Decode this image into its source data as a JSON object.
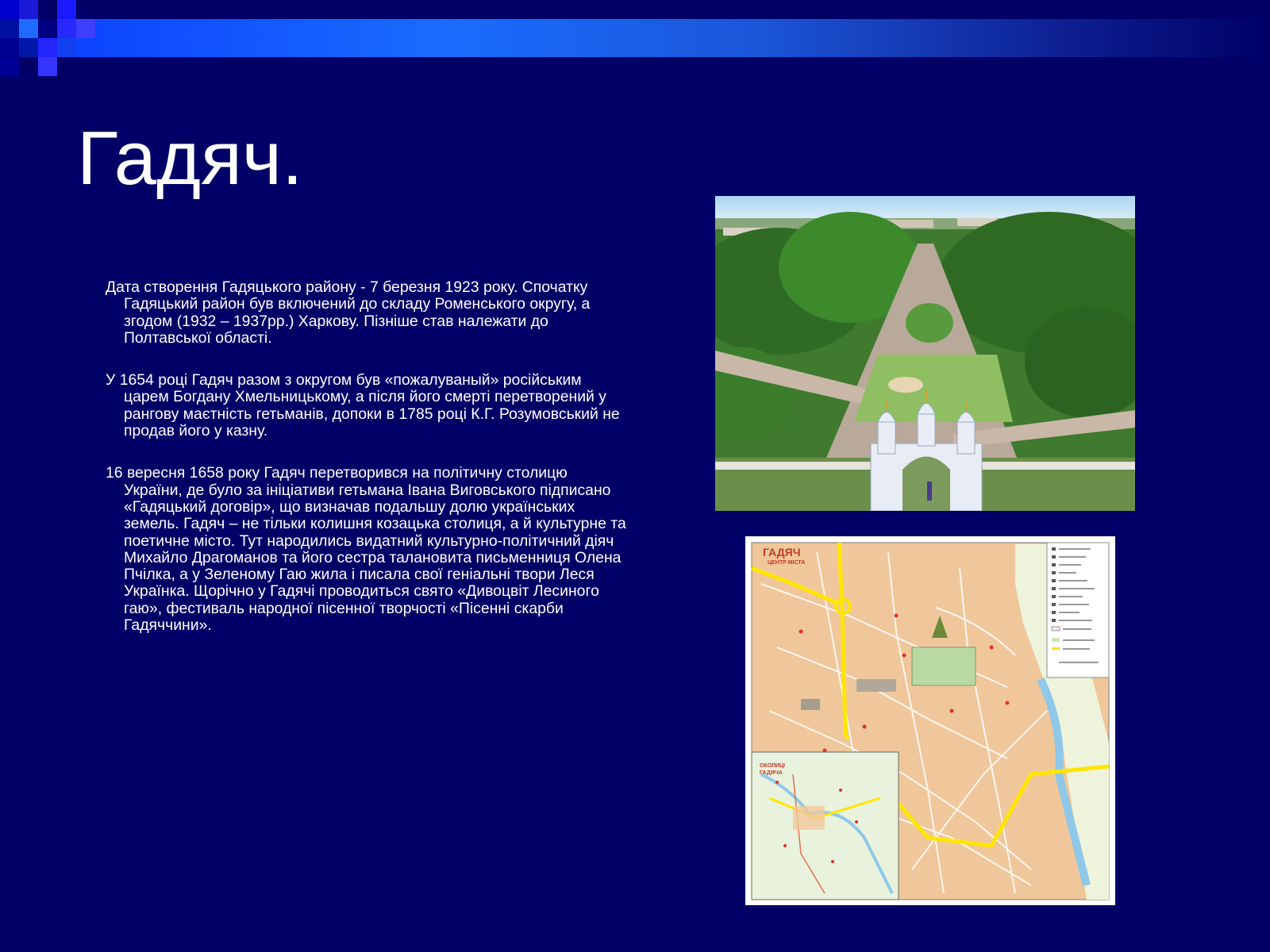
{
  "slide": {
    "title": "Гадяч.",
    "paragraphs": [
      "Дата створення Гадяцького району - 7 березня 1923 року. Спочатку Гадяцький район був включений до складу Роменського округу, а згодом (1932 – 1937рр.) Харкову. Пізніше став належати до Полтавської області.",
      "У 1654 році Гадяч разом з округом  був  «пожалуваный» російським царем Богдану Хмельницькому, а після його смерті  перетворений у  рангову маєтність гетьманів, допоки в 1785 році К.Г. Розумовський не продав його у казну.",
      "16 вересня 1658 року Гадяч перетворився на політичну столицю України, де було за ініціативи гетьмана Івана Виговського підписано «Гадяцький договір», що визначав подальшу долю українських земель. Гадяч – не тільки колишня козацька столиця, а й культурне та поетичне місто. Тут народились видатний культурно-політичний діяч Михайло Драгоманов та його сестра талановита письменниця Олена Пчілка, а у Зеленому Гаю жила і писала свої геніальні твори Леся Українка. Щорічно у Гадячі проводиться свято «Дивоцвіт Лесиного гаю», фестиваль народної пісенної творчості «Пісенні скарби Гадяччини»."
    ]
  },
  "map": {
    "title": "ГАДЯЧ",
    "subtitle": "ЦЕНТР МІСТА",
    "inset_title_line1": "ОКОЛИЦІ",
    "inset_title_line2": "ГАДЯЧА"
  },
  "colors": {
    "background": "#000066",
    "band_start": "#0a3cff",
    "band_end": "#000066",
    "text": "#ffffff"
  }
}
